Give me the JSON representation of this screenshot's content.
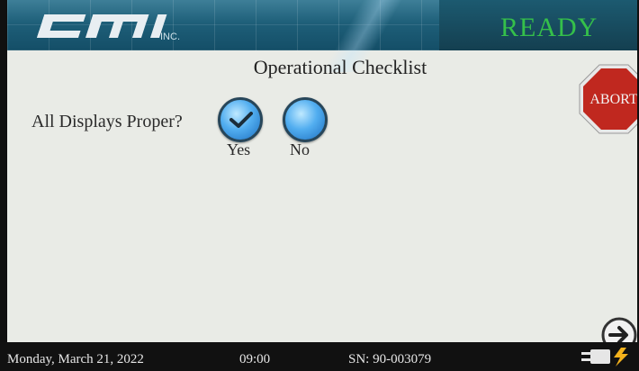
{
  "header": {
    "logo_text": "CMI",
    "logo_suffix": "INC.",
    "status": "READY",
    "status_color": "#35c04a"
  },
  "main": {
    "title": "Operational Checklist",
    "question": "All Displays Proper?",
    "options": [
      {
        "label": "Yes",
        "selected": true
      },
      {
        "label": "No",
        "selected": false
      }
    ]
  },
  "abort_button": {
    "label": "ABORT",
    "color": "#c0281f"
  },
  "next_button": {
    "icon": "arrow-right-icon"
  },
  "footer": {
    "date": "Monday, March 21, 2022",
    "time": "09:00",
    "serial": "SN: 90-003079",
    "power_icon": "plug-icon"
  }
}
